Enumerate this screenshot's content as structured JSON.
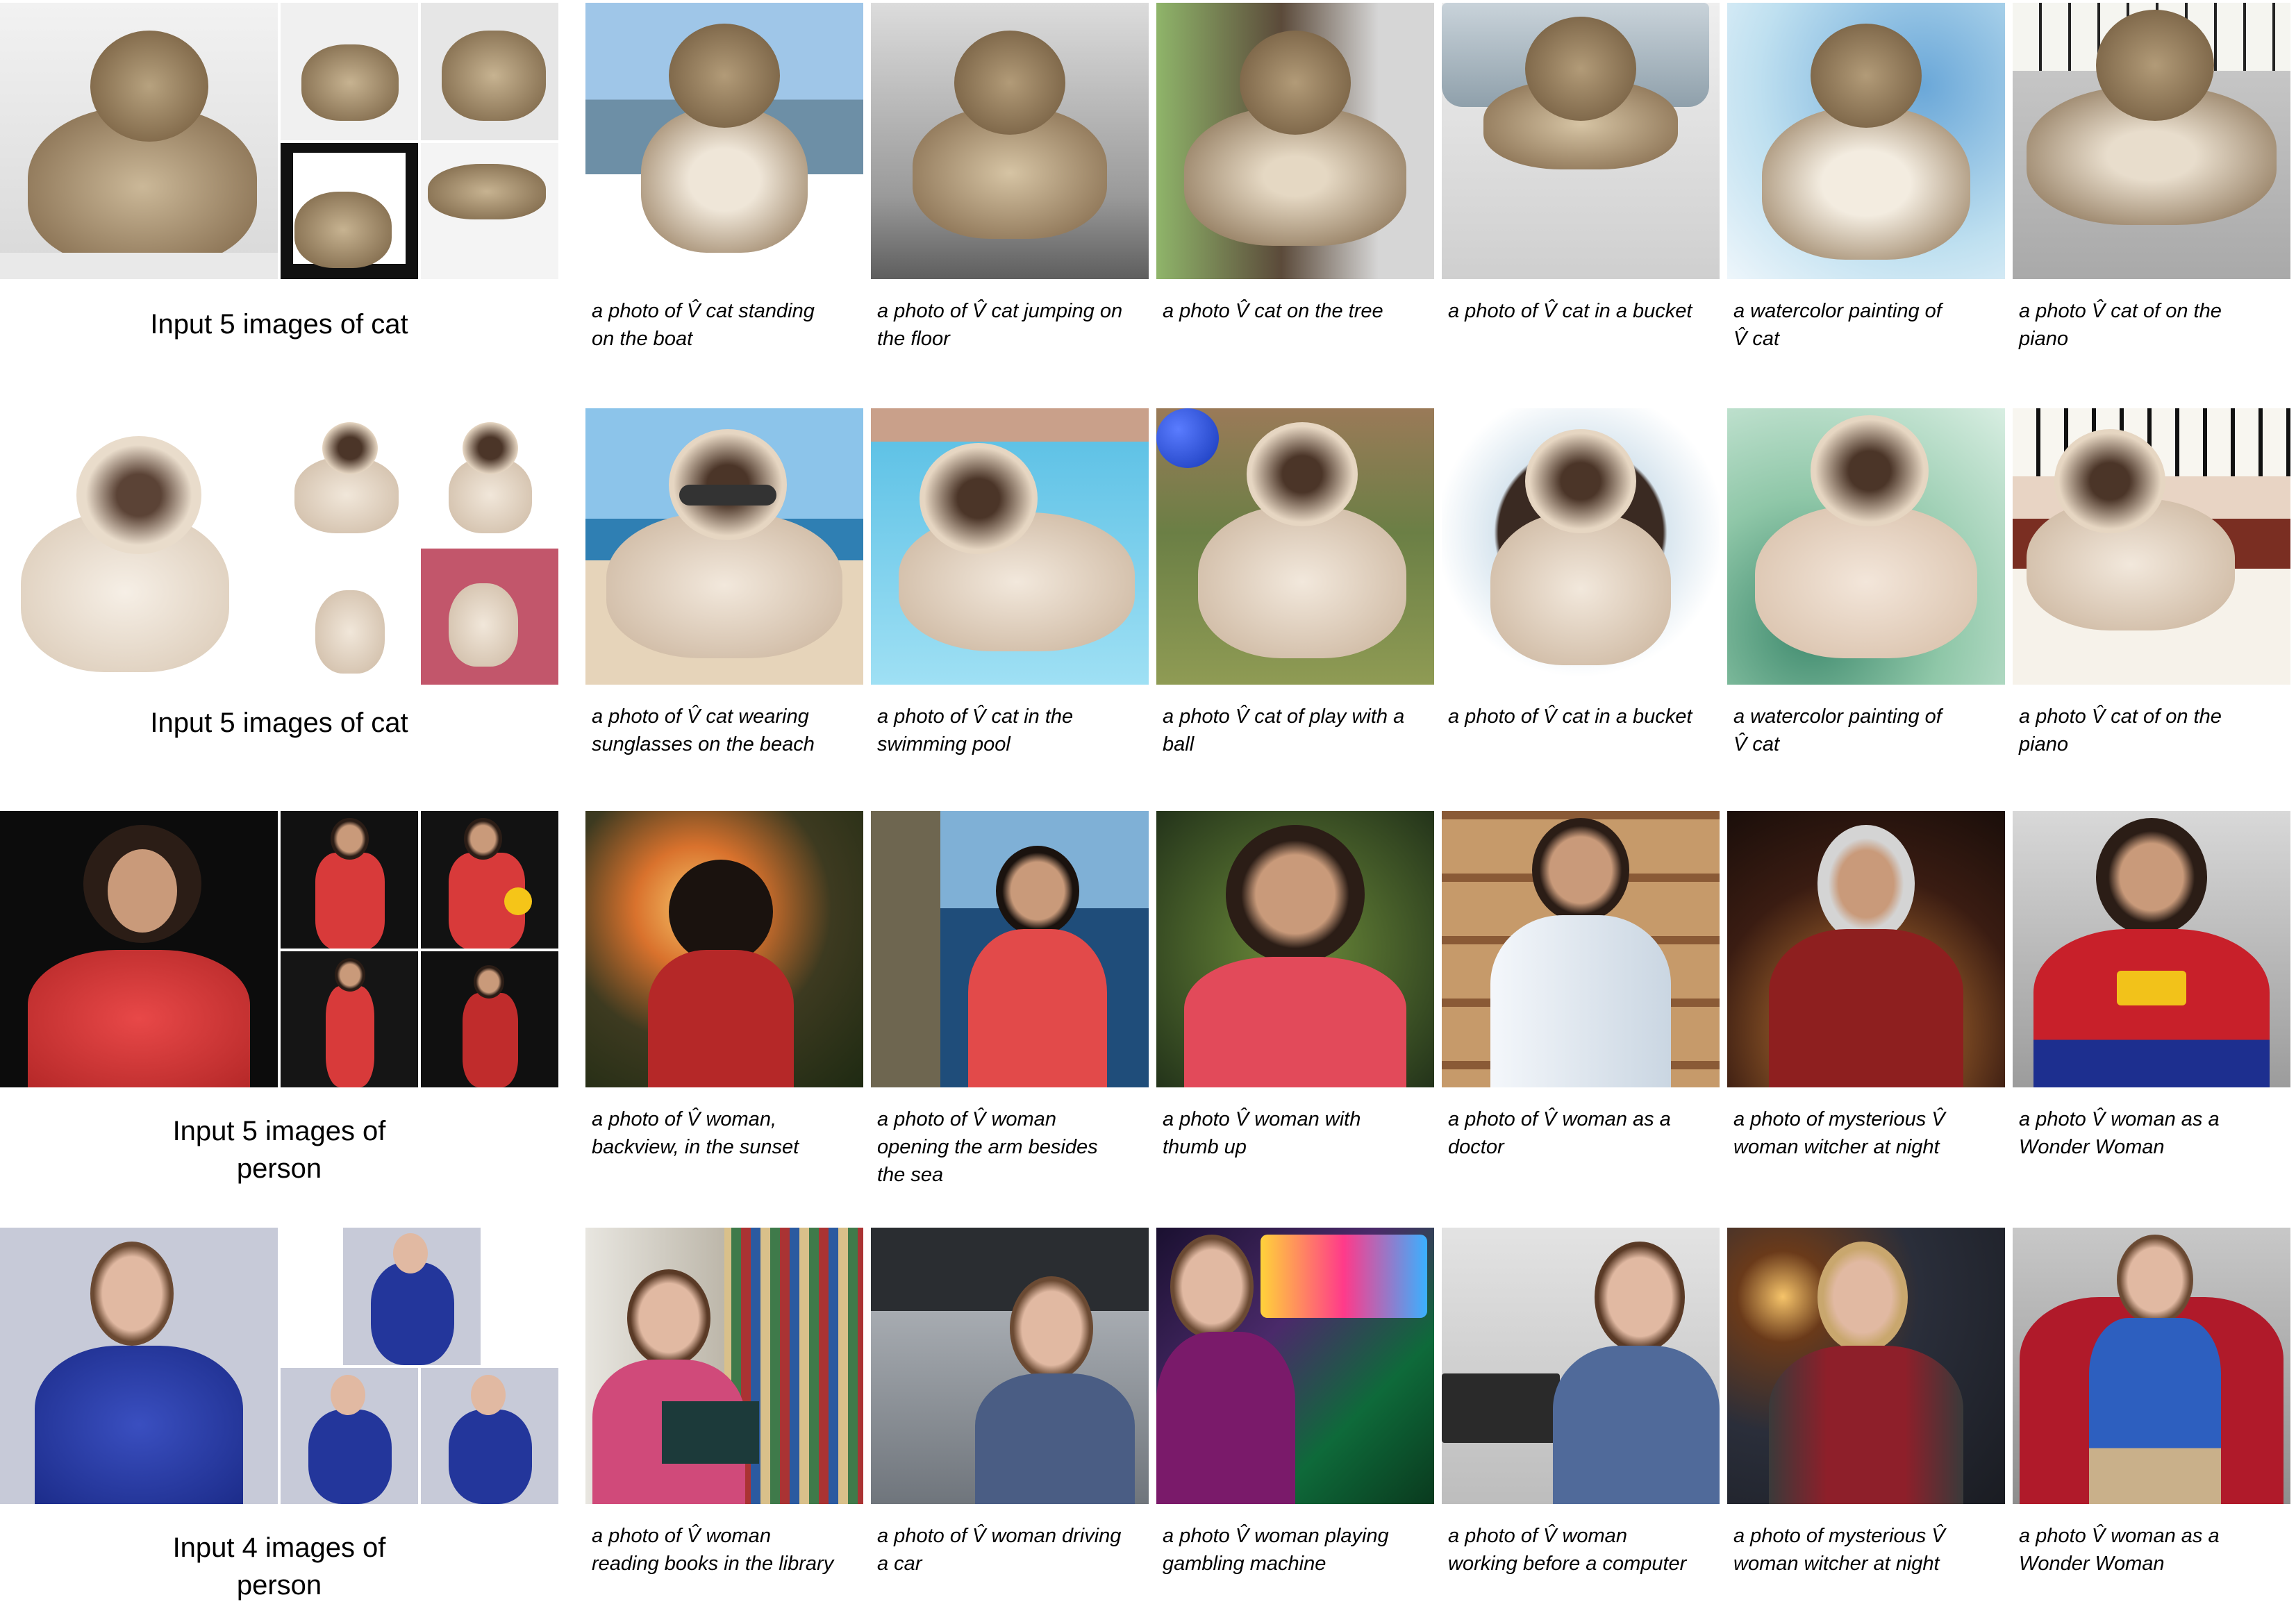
{
  "rows": [
    {
      "input_label": "Input 5 images of cat",
      "subject": "tabby-cat",
      "gens": [
        {
          "caption": "a photo of V̂ cat standing\non the boat",
          "scene": "boat"
        },
        {
          "caption": "a photo of V̂ cat jumping on\nthe floor",
          "scene": "floor"
        },
        {
          "caption": "a photo V̂ cat on the tree",
          "scene": "tree"
        },
        {
          "caption": "a photo of V̂ cat in a bucket",
          "scene": "bucket"
        },
        {
          "caption": "a watercolor painting of\nV̂ cat",
          "scene": "watercolor"
        },
        {
          "caption": "a photo V̂ cat of on the\npiano",
          "scene": "piano"
        }
      ]
    },
    {
      "input_label": "Input 5 images of cat",
      "subject": "siamese-cat",
      "gens": [
        {
          "caption": "a photo of V̂ cat wearing\nsunglasses on the beach",
          "scene": "beach"
        },
        {
          "caption": "a photo of V̂ cat in the\nswimming pool",
          "scene": "pool"
        },
        {
          "caption": "a photo V̂ cat of play with a\nball",
          "scene": "ball"
        },
        {
          "caption": "a photo of V̂ cat in a bucket",
          "scene": "bucket"
        },
        {
          "caption": "a watercolor painting of\nV̂ cat",
          "scene": "watercolor"
        },
        {
          "caption": "a photo V̂ cat of on the\npiano",
          "scene": "piano"
        }
      ]
    },
    {
      "input_label": "Input 5 images of\nperson",
      "subject": "woman-red-dress",
      "gens": [
        {
          "caption": "a photo of V̂ woman,\nbackview, in the sunset",
          "scene": "sunset"
        },
        {
          "caption": "a photo of V̂ woman\nopening the arm besides\nthe sea",
          "scene": "sea"
        },
        {
          "caption": "a photo V̂ woman with\nthumb up",
          "scene": "thumb"
        },
        {
          "caption": "a photo of V̂ woman as a\ndoctor",
          "scene": "doctor"
        },
        {
          "caption": "a photo of mysterious V̂\nwoman witcher at night",
          "scene": "witcher"
        },
        {
          "caption": "a photo V̂ woman as a\nWonder Woman",
          "scene": "wonder"
        }
      ]
    },
    {
      "input_label": "Input 4 images of\nperson",
      "subject": "woman-blue-sweater",
      "gens": [
        {
          "caption": "a photo of V̂ woman\nreading books in the library",
          "scene": "library"
        },
        {
          "caption": "a photo of V̂ woman driving\na car",
          "scene": "car"
        },
        {
          "caption": "a photo V̂ woman playing\ngambling machine",
          "scene": "casino"
        },
        {
          "caption": "a photo of V̂ woman\nworking before a computer",
          "scene": "computer"
        },
        {
          "caption": "a photo of mysterious V̂\nwoman witcher at night",
          "scene": "witcher"
        },
        {
          "caption": "a photo V̂ woman as a\nWonder Woman",
          "scene": "wonder"
        }
      ]
    }
  ],
  "palette": {
    "tabby": "#8a6f4e",
    "tabby_light": "#d9cbb4",
    "siamese": "#eadccb",
    "siamese_point": "#5b4336",
    "red_dress": "#d83a3a",
    "blue_sweater": "#2a3fa6",
    "skin": "#c99a7a",
    "hair_dark": "#2b1d16",
    "hair_brown": "#6b4a33"
  }
}
